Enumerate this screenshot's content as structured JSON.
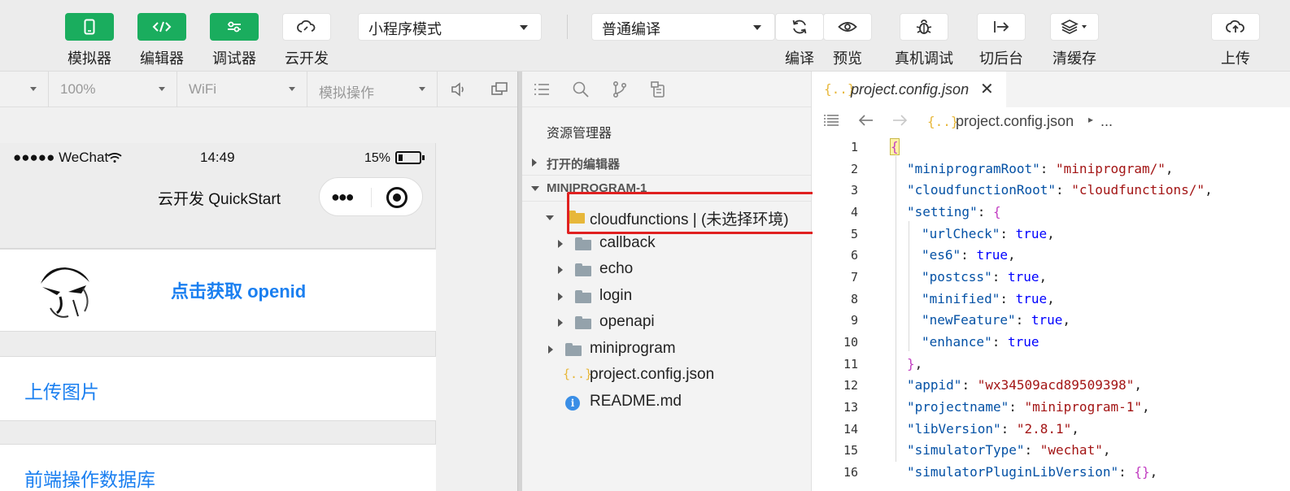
{
  "toolbar": {
    "simulator": "模拟器",
    "editor": "编辑器",
    "debugger": "调试器",
    "cloud": "云开发",
    "mode_select": "小程序模式",
    "compile_select": "普通编译",
    "compile": "编译",
    "preview": "预览",
    "real_debug": "真机调试",
    "background": "切后台",
    "clear_cache": "清缓存",
    "upload": "上传"
  },
  "subbar": {
    "zoom": "100%",
    "network": "WiFi",
    "sim_ops": "模拟操作"
  },
  "phone": {
    "signal": "●●●●● WeChat",
    "time": "14:49",
    "battery": "15%",
    "nav_title": "云开发 QuickStart",
    "openid_btn": "点击获取 openid",
    "upload_img": "上传图片",
    "db_ops": "前端操作数据库"
  },
  "explorer": {
    "title": "资源管理器",
    "open_editors": "打开的编辑器",
    "project": "MINIPROGRAM-1",
    "items": [
      {
        "label": "cloudfunctions | (未选择环境)"
      },
      {
        "label": "callback"
      },
      {
        "label": "echo"
      },
      {
        "label": "login"
      },
      {
        "label": "openapi"
      },
      {
        "label": "miniprogram"
      },
      {
        "label": "project.config.json"
      },
      {
        "label": "README.md"
      }
    ]
  },
  "editor": {
    "tab_name": "project.config.json",
    "crumb_file": "project.config.json",
    "crumb_more": "...",
    "line_numbers": [
      "1",
      "2",
      "3",
      "4",
      "5",
      "6",
      "7",
      "8",
      "9",
      "10",
      "11",
      "12",
      "13",
      "14",
      "15",
      "16"
    ],
    "code": {
      "l2k": "\"miniprogramRoot\"",
      "l2v": "\"miniprogram/\"",
      "l3k": "\"cloudfunctionRoot\"",
      "l3v": "\"cloudfunctions/\"",
      "l4k": "\"setting\"",
      "l5k": "\"urlCheck\"",
      "l6k": "\"es6\"",
      "l7k": "\"postcss\"",
      "l8k": "\"minified\"",
      "l9k": "\"newFeature\"",
      "l10k": "\"enhance\"",
      "true": "true",
      "l12k": "\"appid\"",
      "l12v": "\"wx34509acd89509398\"",
      "l13k": "\"projectname\"",
      "l13v": "\"miniprogram-1\"",
      "l14k": "\"libVersion\"",
      "l14v": "\"2.8.1\"",
      "l15k": "\"simulatorType\"",
      "l15v": "\"wechat\"",
      "l16k": "\"simulatorPluginLibVersion\""
    }
  },
  "colors": {
    "green": "#1aad5e",
    "link_blue": "#1a7ff0",
    "highlight_red": "#e02020",
    "folder_grey": "#94a2ab",
    "json_yellow": "#e7b73a"
  }
}
